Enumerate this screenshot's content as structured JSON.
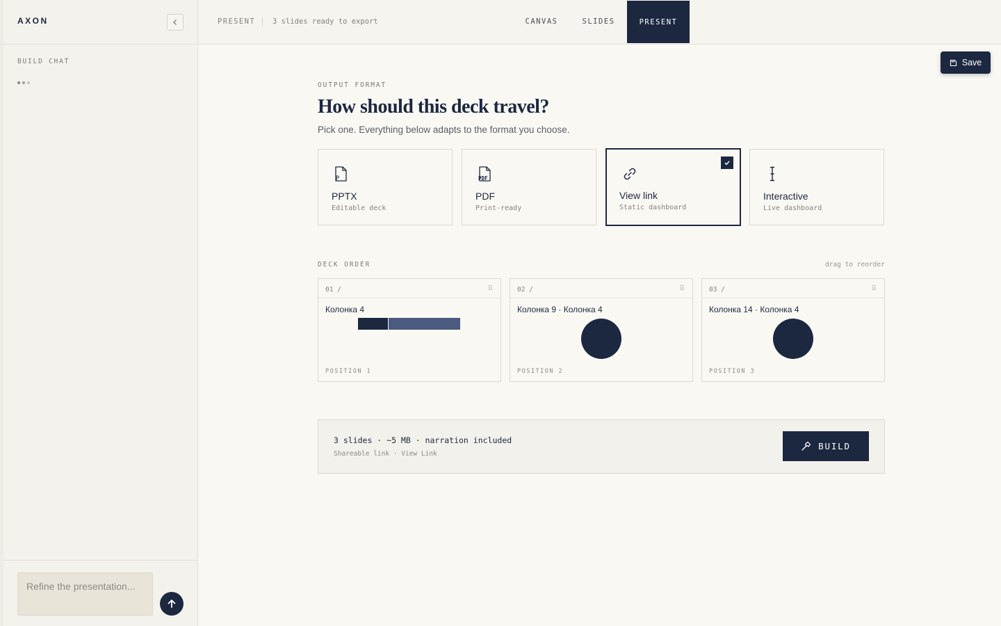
{
  "app": {
    "brand": "AXON"
  },
  "sidebar": {
    "section_label": "BUILD CHAT",
    "input_placeholder": "Refine the presentation..."
  },
  "topbar": {
    "crumb": "PRESENT",
    "status": "3 slides ready to export",
    "tabs": [
      {
        "label": "CANVAS",
        "active": false
      },
      {
        "label": "SLIDES",
        "active": false
      },
      {
        "label": "PRESENT",
        "active": true
      }
    ]
  },
  "actions": {
    "save_label": "Save",
    "build_label": "BUILD"
  },
  "output": {
    "eyebrow": "OUTPUT FORMAT",
    "title": "How should this deck travel?",
    "subtitle": "Pick one. Everything below adapts to the format you choose.",
    "formats": [
      {
        "name": "PPTX",
        "desc": "Editable deck",
        "icon": "pptx-file-icon",
        "selected": false
      },
      {
        "name": "PDF",
        "desc": "Print-ready",
        "icon": "pdf-file-icon",
        "selected": false
      },
      {
        "name": "View link",
        "desc": "Static dashboard",
        "icon": "link-icon",
        "selected": true
      },
      {
        "name": "Interactive",
        "desc": "Live dashboard",
        "icon": "text-cursor-icon",
        "selected": false
      }
    ]
  },
  "deck": {
    "eyebrow": "DECK ORDER",
    "hint": "drag to reorder",
    "slides": [
      {
        "num": "01 /",
        "title": "Колонка 4",
        "position": "POSITION 1",
        "preview": "bar"
      },
      {
        "num": "02 /",
        "title": "Колонка 9 · Колонка 4",
        "position": "POSITION 2",
        "preview": "circle"
      },
      {
        "num": "03 /",
        "title": "Колонка 14 · Колонка 4",
        "position": "POSITION 3",
        "preview": "circle"
      }
    ]
  },
  "summary": {
    "main": "3 slides · ~5 MB · narration included",
    "sub": "Shareable link · View Link"
  },
  "colors": {
    "accent": "#1c2740",
    "background": "#faf8f3",
    "secondary_bar": "#4a5a80"
  }
}
